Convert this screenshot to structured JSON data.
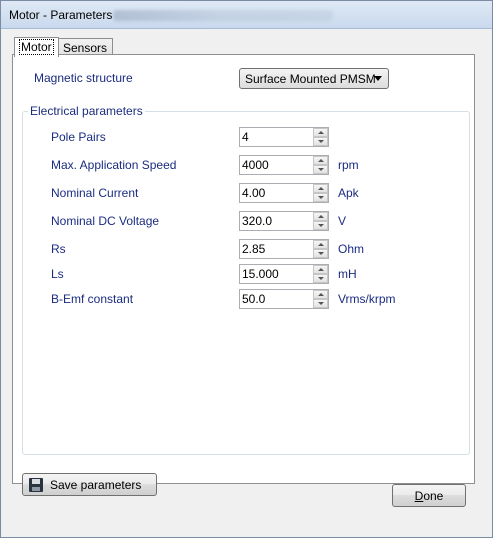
{
  "window": {
    "title": "Motor - Parameters"
  },
  "tabs": [
    {
      "label": "Motor",
      "active": true
    },
    {
      "label": "Sensors",
      "active": false
    }
  ],
  "magnetic": {
    "label": "Magnetic structure",
    "value": "Surface Mounted PMSM"
  },
  "electrical": {
    "group_title": "Electrical parameters",
    "rows": [
      {
        "label": "Pole Pairs",
        "value": "4",
        "unit": ""
      },
      {
        "label": "Max. Application Speed",
        "value": "4000",
        "unit": "rpm"
      },
      {
        "label": "Nominal Current",
        "value": "4.00",
        "unit": "Apk"
      },
      {
        "label": "Nominal DC Voltage",
        "value": "320.0",
        "unit": "V"
      },
      {
        "label": "Rs",
        "value": "2.85",
        "unit": "Ohm"
      },
      {
        "label": "Ls",
        "value": "15.000",
        "unit": "mH"
      },
      {
        "label": "B-Emf constant",
        "value": "50.0",
        "unit": "Vrms/krpm"
      }
    ]
  },
  "buttons": {
    "save_label": "Save parameters",
    "done_label_first": "D",
    "done_label_rest": "one"
  },
  "icons": {
    "save": "floppy-disk-icon",
    "spin_up": "chevron-up-icon",
    "spin_down": "chevron-down-icon",
    "combo": "dropdown-arrow-icon"
  },
  "colors": {
    "label_text": "#1a2c80",
    "panel_bg": "#ffffff",
    "window_bg": "#f0f0f0"
  }
}
